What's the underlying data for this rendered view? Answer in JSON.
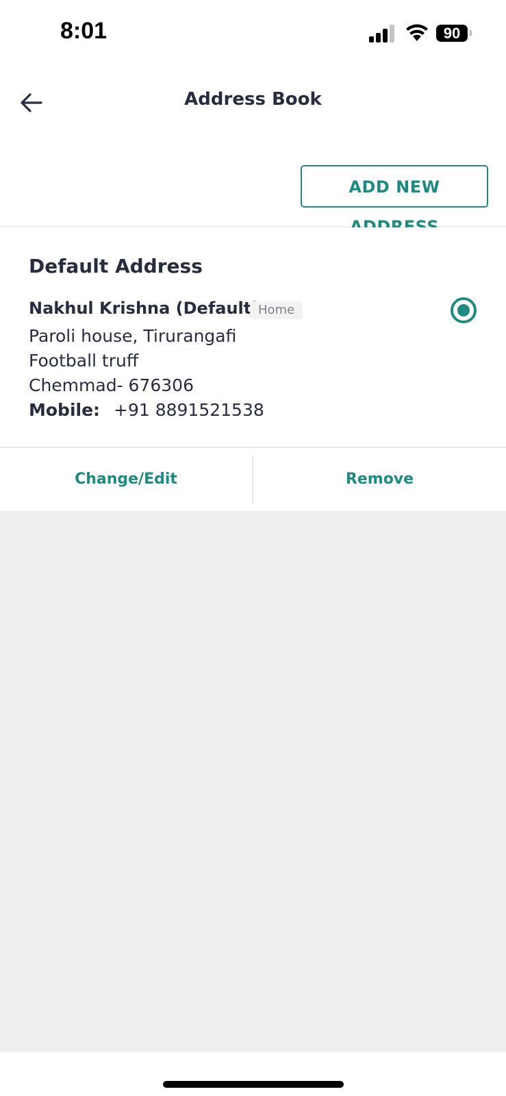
{
  "status_bar": {
    "time": "8:01",
    "battery": "90",
    "icons": [
      "signal-icon",
      "wifi-icon",
      "battery-icon"
    ]
  },
  "header": {
    "title": "Address Book",
    "back_icon": "arrow-left-icon"
  },
  "toolbar": {
    "add_label": "ADD NEW ADDRESS"
  },
  "address": {
    "section_title": "Default Address",
    "name": "Nakhul Krishna (Default)",
    "tag": "Home",
    "line1": "Paroli house, Tirurangafi",
    "line2": "Football truff",
    "line3": "Chemmad- 676306",
    "mobile_label": "Mobile:",
    "mobile_value": "+91 8891521538",
    "selected": true
  },
  "actions": {
    "edit_label": "Change/Edit",
    "remove_label": "Remove"
  },
  "colors": {
    "accent": "#1e8a82",
    "text": "#282c3f",
    "background_gray": "#eeeeee"
  }
}
